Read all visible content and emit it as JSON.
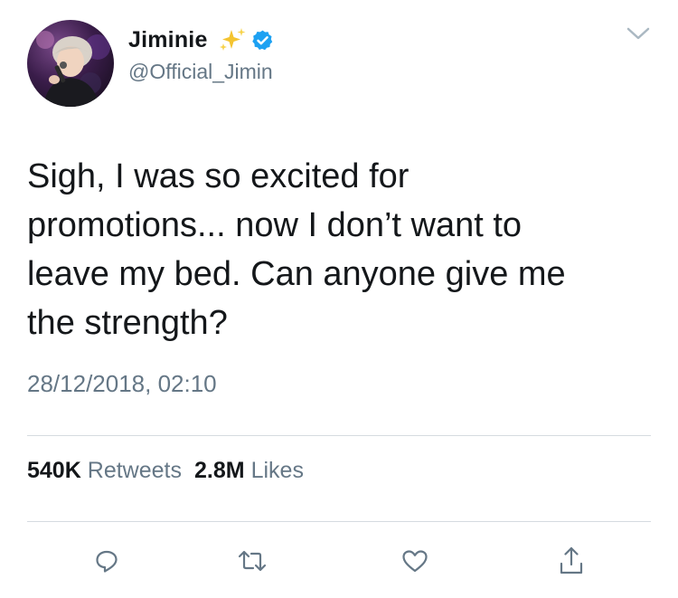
{
  "author": {
    "display_name": "Jiminie",
    "handle": "@Official_Jimin",
    "emoji": "sparkles",
    "verified": true
  },
  "tweet": {
    "text": "Sigh, I was so excited for\npromotions... now I don’t want to\nleave my bed. Can anyone give me\nthe strength?",
    "timestamp": "28/12/2018, 02:10"
  },
  "stats": {
    "retweets_count": "540K",
    "retweets_label": "Retweets",
    "likes_count": "2.8M",
    "likes_label": "Likes"
  },
  "actions": [
    "reply-icon",
    "retweet-icon",
    "like-icon",
    "share-icon"
  ],
  "colors": {
    "text_primary": "#14171a",
    "text_secondary": "#657786",
    "divider": "#d5dbe0",
    "verified_blue": "#1da1f2",
    "sparkle_gold": "#f4c430"
  }
}
